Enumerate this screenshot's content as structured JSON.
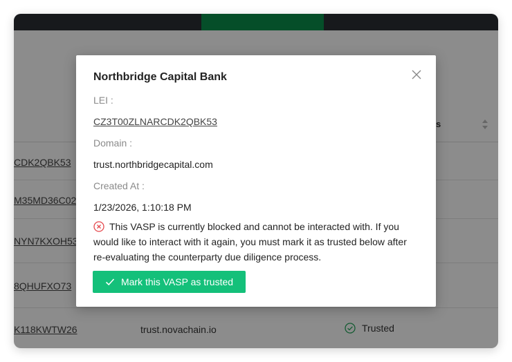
{
  "table": {
    "status_header": "s",
    "rows": [
      {
        "lei": "CDK2QBK53",
        "domain": "",
        "status": ""
      },
      {
        "lei": "M35MD36C02",
        "domain": "",
        "status": ""
      },
      {
        "lei": "NYN7KXOH53",
        "domain": "",
        "status": ""
      },
      {
        "lei": "8QHUFXO73",
        "domain": "",
        "status": ""
      },
      {
        "lei": "K118KWTW26",
        "domain": "trust.novachain.io",
        "status": "Trusted"
      }
    ]
  },
  "modal": {
    "title": "Northbridge Capital Bank",
    "lei_label": "LEI :",
    "lei_value": "CZ3T00ZLNARCDK2QBK53",
    "domain_label": "Domain :",
    "domain_value": "trust.northbridgecapital.com",
    "created_label": "Created At :",
    "created_value": "1/23/2026, 1:10:18 PM",
    "warning": "This VASP is currently blocked and cannot be interacted with. If you would like to interact with it again, you must mark it as trusted below after re-evaluating the counterparty due diligence process.",
    "button_label": "Mark this VASP as trusted"
  },
  "colors": {
    "accent_green": "#14c07a",
    "topbar_dark": "#2b2f33",
    "active_tab": "#0a8f4c",
    "error_red": "#e5484d",
    "success_green": "#23a65a"
  },
  "icons": {
    "close": "close-icon",
    "warning": "error-circle-icon",
    "check": "check-icon",
    "sort": "sort-icon",
    "trusted": "check-circle-icon"
  }
}
